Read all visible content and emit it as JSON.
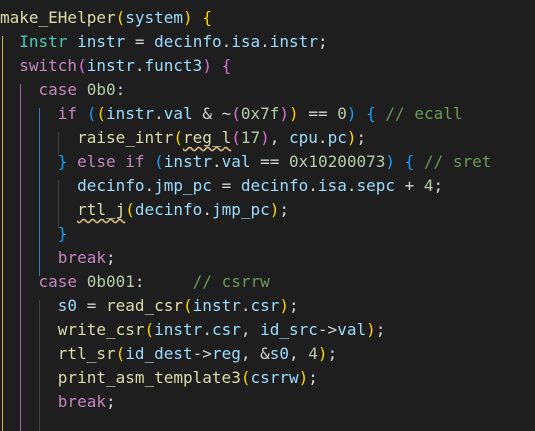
{
  "theme": {
    "background": "#1e1e1e",
    "keyword": "#c586c0",
    "type": "#4ec9b0",
    "function": "#dcdcaa",
    "variable": "#9cdcfe",
    "number": "#b5cea8",
    "comment": "#6a9955",
    "bracket_level_1": "#ffd700",
    "bracket_level_2": "#da70d6",
    "bracket_level_3": "#179fff"
  },
  "code": {
    "language": "c",
    "lines": [
      [
        [
          "fn",
          "make_EHelper"
        ],
        [
          "b1",
          "("
        ],
        [
          "var",
          "system"
        ],
        [
          "b1",
          ")"
        ],
        [
          "op",
          " "
        ],
        [
          "b1",
          "{"
        ]
      ],
      [
        [
          "op",
          "  "
        ],
        [
          "typ",
          "Instr"
        ],
        [
          "op",
          " "
        ],
        [
          "var",
          "instr"
        ],
        [
          "op",
          " = "
        ],
        [
          "var",
          "decinfo"
        ],
        [
          "op",
          "."
        ],
        [
          "var",
          "isa"
        ],
        [
          "op",
          "."
        ],
        [
          "var",
          "instr"
        ],
        [
          "op",
          ";"
        ]
      ],
      [
        [
          "op",
          "  "
        ],
        [
          "kw",
          "switch"
        ],
        [
          "b2",
          "("
        ],
        [
          "var",
          "instr"
        ],
        [
          "op",
          "."
        ],
        [
          "var",
          "funct3"
        ],
        [
          "b2",
          ")"
        ],
        [
          "op",
          " "
        ],
        [
          "b2",
          "{"
        ]
      ],
      [
        [
          "op",
          "    "
        ],
        [
          "kw",
          "case"
        ],
        [
          "op",
          " "
        ],
        [
          "num",
          "0b0"
        ],
        [
          "op",
          ":"
        ]
      ],
      [
        [
          "op",
          "      "
        ],
        [
          "kw",
          "if"
        ],
        [
          "op",
          " "
        ],
        [
          "b3",
          "("
        ],
        [
          "b1",
          "("
        ],
        [
          "var",
          "instr"
        ],
        [
          "op",
          "."
        ],
        [
          "var",
          "val"
        ],
        [
          "op",
          " & ~"
        ],
        [
          "b2",
          "("
        ],
        [
          "num",
          "0x7f"
        ],
        [
          "b2",
          ")"
        ],
        [
          "b1",
          ")"
        ],
        [
          "op",
          " == "
        ],
        [
          "num",
          "0"
        ],
        [
          "b3",
          ")"
        ],
        [
          "op",
          " "
        ],
        [
          "b3",
          "{"
        ],
        [
          "op",
          " "
        ],
        [
          "cmt",
          "// ecall"
        ]
      ],
      [
        [
          "op",
          "        "
        ],
        [
          "fn",
          "raise_intr"
        ],
        [
          "b1",
          "("
        ],
        [
          "fnu",
          "reg_l"
        ],
        [
          "b2",
          "("
        ],
        [
          "num",
          "17"
        ],
        [
          "b2",
          ")"
        ],
        [
          "op",
          ", "
        ],
        [
          "var",
          "cpu"
        ],
        [
          "op",
          "."
        ],
        [
          "var",
          "pc"
        ],
        [
          "b1",
          ")"
        ],
        [
          "op",
          ";"
        ]
      ],
      [
        [
          "op",
          "      "
        ],
        [
          "b3",
          "}"
        ],
        [
          "op",
          " "
        ],
        [
          "kw",
          "else"
        ],
        [
          "op",
          " "
        ],
        [
          "kw",
          "if"
        ],
        [
          "op",
          " "
        ],
        [
          "b3",
          "("
        ],
        [
          "var",
          "instr"
        ],
        [
          "op",
          "."
        ],
        [
          "var",
          "val"
        ],
        [
          "op",
          " == "
        ],
        [
          "num",
          "0x10200073"
        ],
        [
          "b3",
          ")"
        ],
        [
          "op",
          " "
        ],
        [
          "b3",
          "{"
        ],
        [
          "op",
          " "
        ],
        [
          "cmt",
          "// sret"
        ]
      ],
      [
        [
          "op",
          "        "
        ],
        [
          "var",
          "decinfo"
        ],
        [
          "op",
          "."
        ],
        [
          "var",
          "jmp_pc"
        ],
        [
          "op",
          " = "
        ],
        [
          "var",
          "decinfo"
        ],
        [
          "op",
          "."
        ],
        [
          "var",
          "isa"
        ],
        [
          "op",
          "."
        ],
        [
          "var",
          "sepc"
        ],
        [
          "op",
          " + "
        ],
        [
          "num",
          "4"
        ],
        [
          "op",
          ";"
        ]
      ],
      [
        [
          "op",
          "        "
        ],
        [
          "fnu",
          "rtl_j"
        ],
        [
          "b1",
          "("
        ],
        [
          "var",
          "decinfo"
        ],
        [
          "op",
          "."
        ],
        [
          "var",
          "jmp_pc"
        ],
        [
          "b1",
          ")"
        ],
        [
          "op",
          ";"
        ]
      ],
      [
        [
          "op",
          "      "
        ],
        [
          "b3",
          "}"
        ]
      ],
      [
        [
          "op",
          "      "
        ],
        [
          "kw",
          "break"
        ],
        [
          "op",
          ";"
        ]
      ],
      [
        [
          "op",
          "    "
        ],
        [
          "kw",
          "case"
        ],
        [
          "op",
          " "
        ],
        [
          "num",
          "0b001"
        ],
        [
          "op",
          ":     "
        ],
        [
          "cmt",
          "// csrrw"
        ]
      ],
      [
        [
          "op",
          "      "
        ],
        [
          "var",
          "s0"
        ],
        [
          "op",
          " = "
        ],
        [
          "fn",
          "read_csr"
        ],
        [
          "b1",
          "("
        ],
        [
          "var",
          "instr"
        ],
        [
          "op",
          "."
        ],
        [
          "var",
          "csr"
        ],
        [
          "b1",
          ")"
        ],
        [
          "op",
          ";"
        ]
      ],
      [
        [
          "op",
          "      "
        ],
        [
          "fn",
          "write_csr"
        ],
        [
          "b1",
          "("
        ],
        [
          "var",
          "instr"
        ],
        [
          "op",
          "."
        ],
        [
          "var",
          "csr"
        ],
        [
          "op",
          ", "
        ],
        [
          "var",
          "id_src"
        ],
        [
          "op",
          "->"
        ],
        [
          "var",
          "val"
        ],
        [
          "b1",
          ")"
        ],
        [
          "op",
          ";"
        ]
      ],
      [
        [
          "op",
          "      "
        ],
        [
          "fn",
          "rtl_sr"
        ],
        [
          "b1",
          "("
        ],
        [
          "var",
          "id_dest"
        ],
        [
          "op",
          "->"
        ],
        [
          "var",
          "reg"
        ],
        [
          "op",
          ", &"
        ],
        [
          "var",
          "s0"
        ],
        [
          "op",
          ", "
        ],
        [
          "num",
          "4"
        ],
        [
          "b1",
          ")"
        ],
        [
          "op",
          ";"
        ]
      ],
      [
        [
          "op",
          "      "
        ],
        [
          "fn",
          "print_asm_template3"
        ],
        [
          "b1",
          "("
        ],
        [
          "var",
          "csrrw"
        ],
        [
          "b1",
          ")"
        ],
        [
          "op",
          ";"
        ]
      ],
      [
        [
          "op",
          "      "
        ],
        [
          "kw",
          "break"
        ],
        [
          "op",
          ";"
        ]
      ]
    ]
  }
}
